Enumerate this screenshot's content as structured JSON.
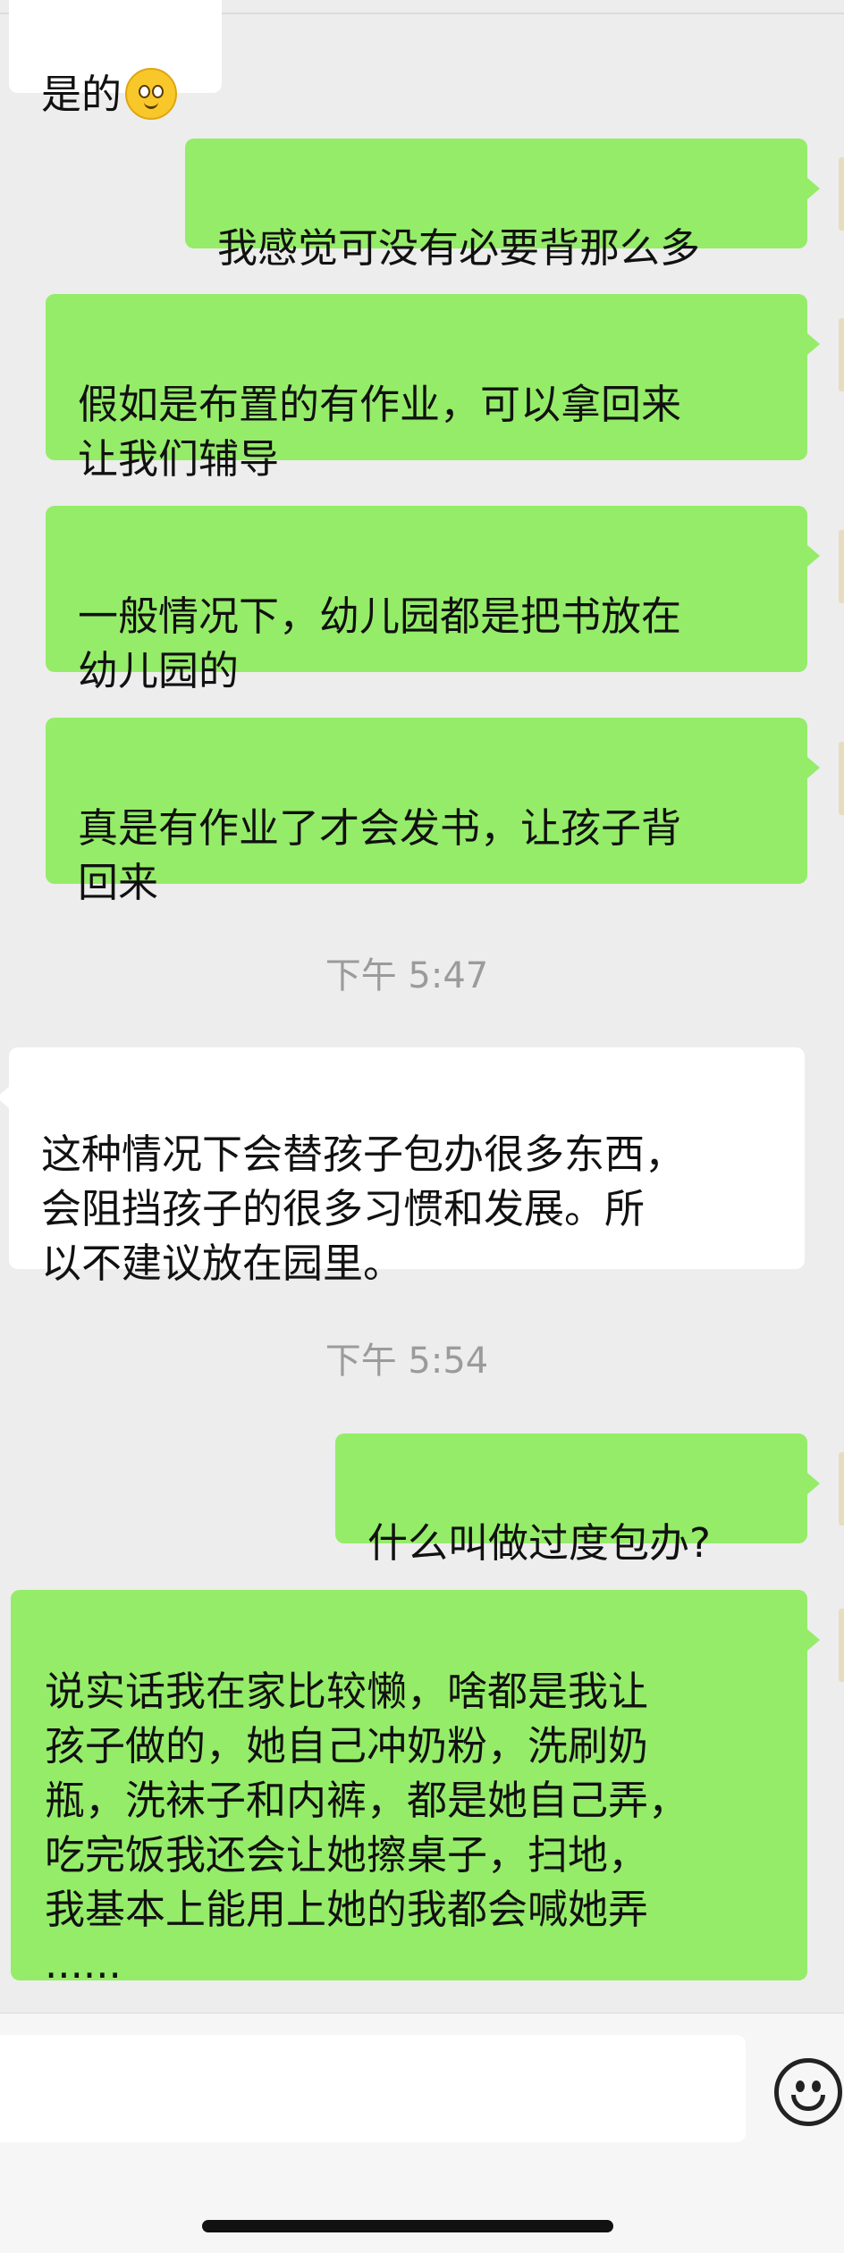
{
  "messages": [
    {
      "text": "是的",
      "has_emoji": true,
      "emoji": "smiling-face-icon"
    },
    {
      "text": "我感觉可没有必要背那么多"
    },
    {
      "text": "假如是布置的有作业，可以拿回来\n让我们辅导"
    },
    {
      "text": "一般情况下，幼儿园都是把书放在\n幼儿园的"
    },
    {
      "text": "真是有作业了才会发书，让孩子背\n回来"
    },
    {
      "text": "这种情况下会替孩子包办很多东西，\n会阻挡孩子的很多习惯和发展。所\n以不建议放在园里。"
    },
    {
      "text": "什么叫做过度包办?"
    },
    {
      "text": "说实话我在家比较懒，啥都是我让\n孩子做的，她自己冲奶粉，洗刷奶\n瓶，洗袜子和内裤，都是她自己弄，\n吃完饭我还会让她擦桌子，扫地，\n我基本上能用上她的我都会喊她弄\n......"
    }
  ],
  "timestamps": [
    "下午 5:47",
    "下午 5:54"
  ],
  "colors": {
    "background": "#ededed",
    "incoming_bubble": "#ffffff",
    "outgoing_bubble": "#95ec69",
    "timestamp_text": "#9b9b9b"
  },
  "input_bar": {
    "emoji_button_icon": "emoji-face-icon"
  }
}
